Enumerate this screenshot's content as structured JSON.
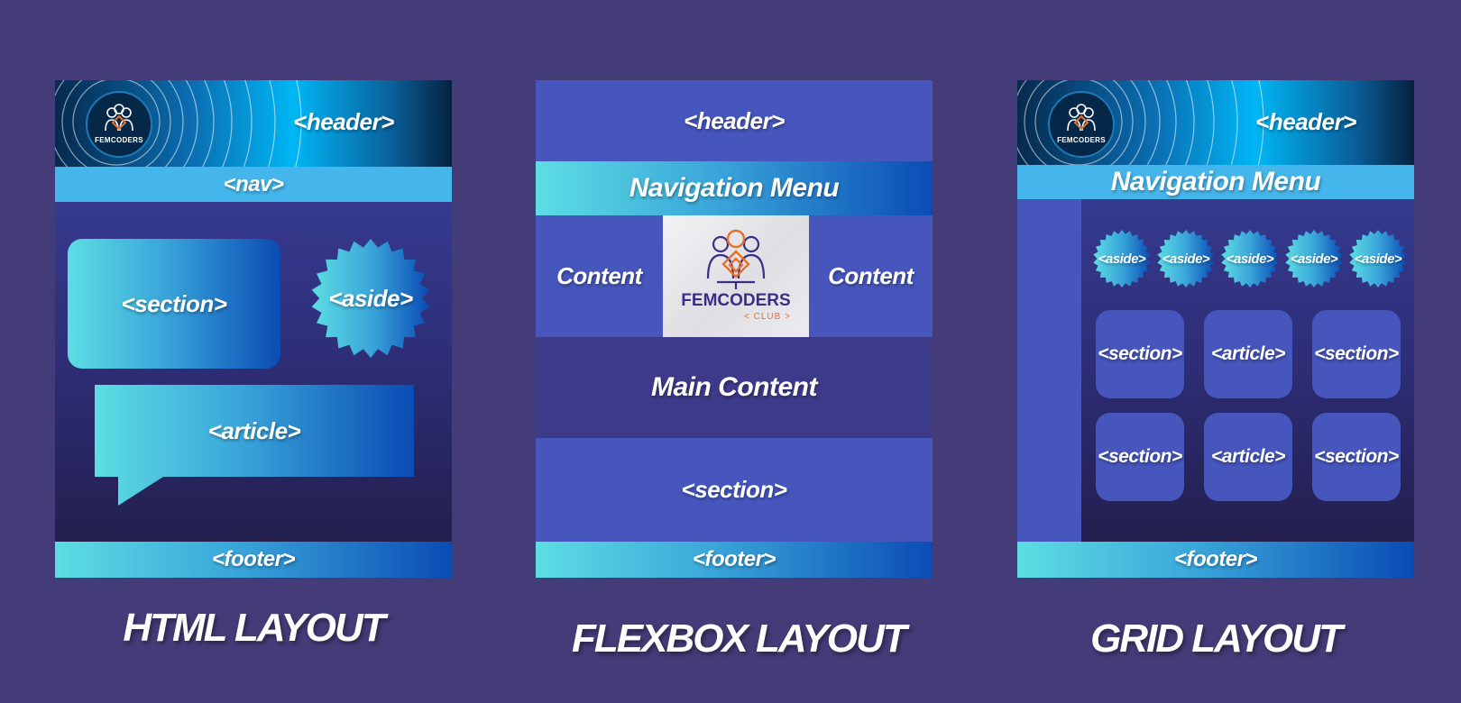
{
  "html_layout": {
    "logo_text": "FEMCODERS",
    "header": "<header>",
    "nav": "<nav>",
    "section": "<section>",
    "aside": "<aside>",
    "article": "<article>",
    "footer": "<footer>",
    "caption": "HTML LAYOUT"
  },
  "flexbox_layout": {
    "header": "<header>",
    "nav": "Navigation Menu",
    "content_left": "Content",
    "content_right": "Content",
    "logo_title": "FEMCODERS",
    "logo_sub": "< CLUB >",
    "main": "Main Content",
    "section": "<section>",
    "footer": "<footer>",
    "caption": "FLEXBOX LAYOUT"
  },
  "grid_layout": {
    "logo_text": "FEMCODERS",
    "header": "<header>",
    "nav": "Navigation Menu",
    "asides": [
      "<aside>",
      "<aside>",
      "<aside>",
      "<aside>",
      "<aside>"
    ],
    "row1": [
      "<section>",
      "<article>",
      "<section>"
    ],
    "row2": [
      "<section>",
      "<article>",
      "<section>"
    ],
    "footer": "<footer>",
    "caption": "GRID LAYOUT"
  },
  "colors": {
    "background": "#443c78",
    "flex_blue": "#4656bd",
    "main_dark": "#3e3a8a",
    "nav_light": "#45b6ec",
    "logo_orange": "#e8702a",
    "logo_navy": "#3b2e86"
  }
}
